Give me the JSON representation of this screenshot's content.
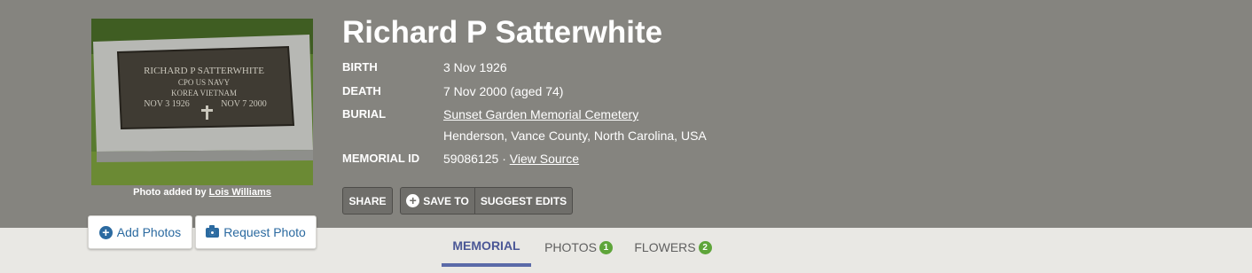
{
  "memorial": {
    "name": "Richard P Satterwhite",
    "facts": {
      "birth": {
        "label": "BIRTH",
        "value": "3 Nov 1926"
      },
      "death": {
        "label": "DEATH",
        "value": "7 Nov 2000 (aged 74)"
      },
      "burial": {
        "label": "BURIAL",
        "cemetery": "Sunset Garden Memorial Cemetery",
        "location": "Henderson, Vance County, North Carolina, USA"
      },
      "memorial_id": {
        "label": "MEMORIAL ID",
        "value": "59086125",
        "separator": "·",
        "source_link": "View Source"
      }
    }
  },
  "photo": {
    "credit_prefix": "Photo added by",
    "credit_name": "Lois Williams",
    "plaque_lines": [
      "RICHARD P SATTERWHITE",
      "CPO US NAVY",
      "KOREA VIETNAM",
      "NOV 3 1926",
      "NOV 7 2000"
    ]
  },
  "actions": {
    "share": "SHARE",
    "save_to": "SAVE TO",
    "suggest_edits": "SUGGEST EDITS",
    "add_photos": "Add Photos",
    "request_photo": "Request Photo"
  },
  "tabs": [
    {
      "label": "MEMORIAL",
      "active": true
    },
    {
      "label": "PHOTOS",
      "count": "1"
    },
    {
      "label": "FLOWERS",
      "count": "2"
    }
  ],
  "colors": {
    "hero_bg": "#85847f",
    "active_tab": "#4b5796",
    "badge": "#5ea53a",
    "link_blue": "#2b6aa0"
  },
  "icons": {
    "save_to": "plus-circle-icon",
    "add_photos": "plus-circle-icon",
    "request_photo": "camera-icon"
  }
}
